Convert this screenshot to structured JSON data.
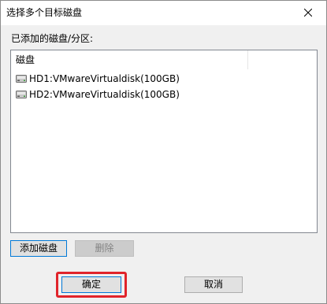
{
  "window": {
    "title": "选择多个目标磁盘"
  },
  "list_section": {
    "label": "已添加的磁盘/分区:",
    "column_header": "磁盘",
    "rows": [
      {
        "label": "HD1:VMwareVirtualdisk(100GB)",
        "icon": "hard-disk-icon"
      },
      {
        "label": "HD2:VMwareVirtualdisk(100GB)",
        "icon": "hard-disk-icon"
      }
    ]
  },
  "actions": {
    "add_label": "添加磁盘",
    "delete_label": "删除",
    "ok_label": "确定",
    "cancel_label": "取消"
  },
  "colors": {
    "accent": "#0078d7",
    "highlight": "#e0242b",
    "dialog_bg": "#f0f0f0"
  }
}
